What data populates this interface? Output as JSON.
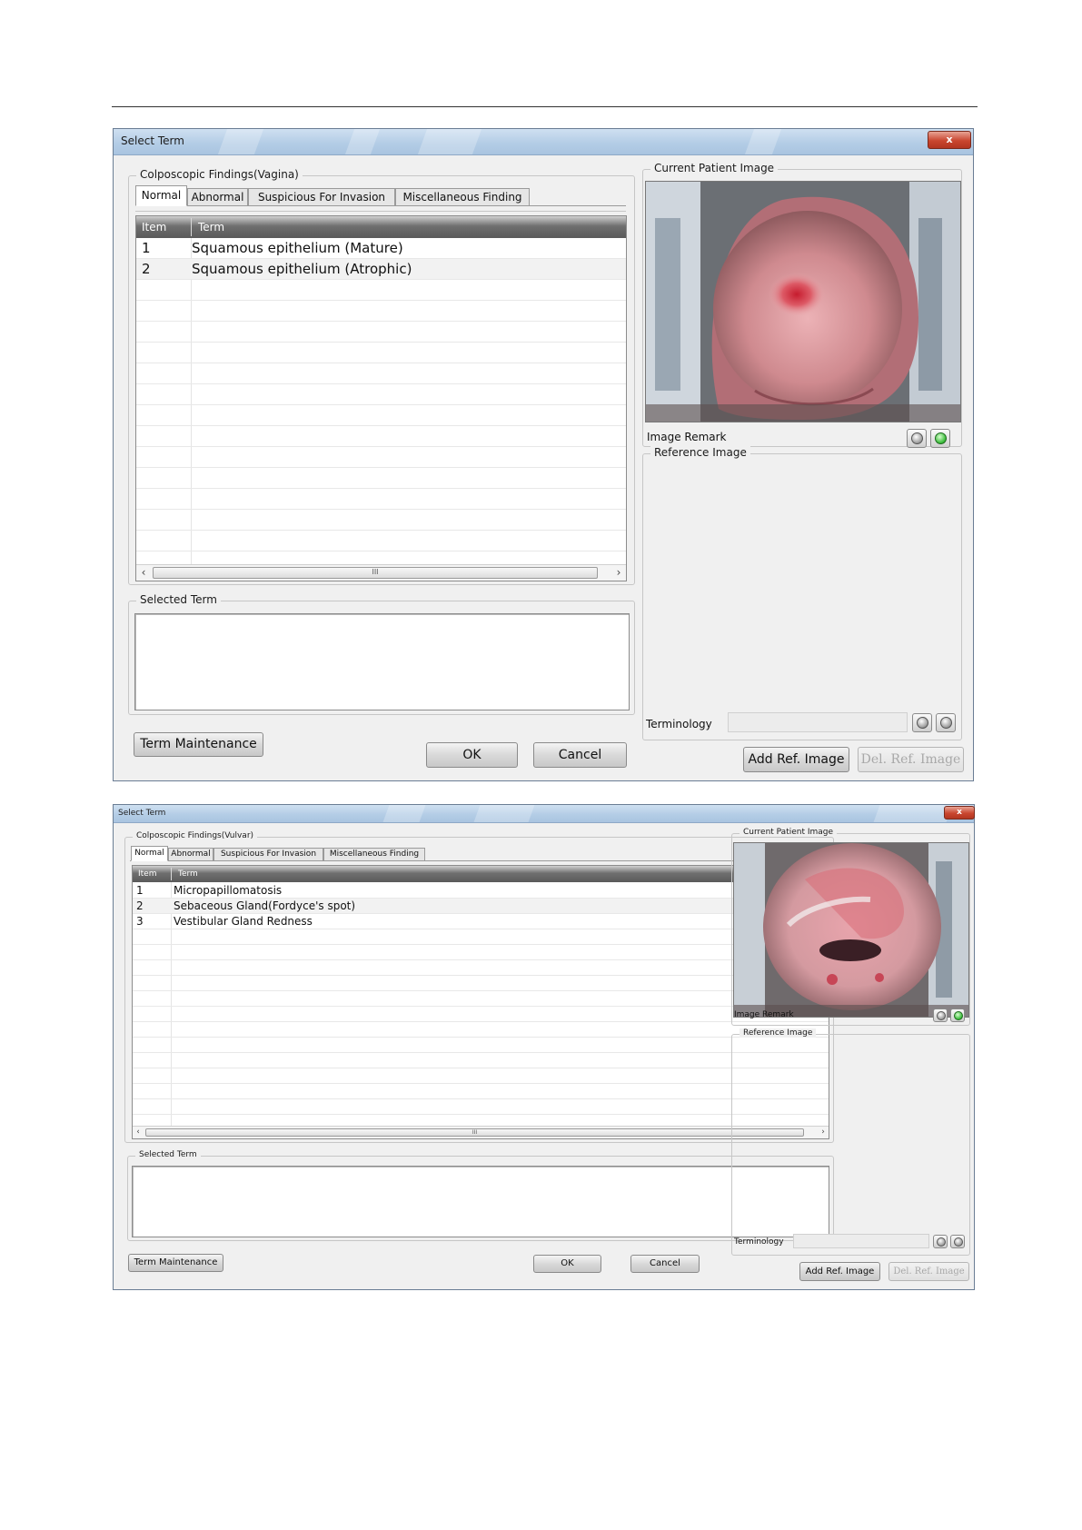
{
  "dialog1": {
    "title": "Select Term",
    "close_label": "x",
    "findings_group": "Colposcopic Findings(Vagina)",
    "tabs": [
      "Normal",
      "Abnormal",
      "Suspicious For Invasion",
      "Miscellaneous Finding"
    ],
    "active_tab": "Normal",
    "columns": [
      "Item",
      "Term"
    ],
    "rows": [
      {
        "item": "1",
        "term": "Squamous epithelium (Mature)"
      },
      {
        "item": "2",
        "term": "Squamous epithelium (Atrophic)"
      }
    ],
    "scroll_left": "‹",
    "scroll_right": "›",
    "scroll_thumb": "III",
    "selected_term_group": "Selected Term",
    "term_maintenance": "Term Maintenance",
    "ok": "OK",
    "cancel": "Cancel",
    "current_image_group": "Current Patient Image",
    "image_remark": "Image Remark",
    "reference_image_group": "Reference Image",
    "terminology": "Terminology",
    "add_ref": "Add Ref. Image",
    "del_ref": "Del. Ref. Image"
  },
  "dialog2": {
    "title": "Select Term",
    "close_label": "x",
    "findings_group": "Colposcopic Findings(Vulvar)",
    "tabs": [
      "Normal",
      "Abnormal",
      "Suspicious For Invasion",
      "Miscellaneous Finding"
    ],
    "active_tab": "Normal",
    "columns": [
      "Item",
      "Term"
    ],
    "rows": [
      {
        "item": "1",
        "term": "Micropapillomatosis"
      },
      {
        "item": "2",
        "term": "Sebaceous Gland(Fordyce's spot)"
      },
      {
        "item": "3",
        "term": "Vestibular Gland Redness"
      }
    ],
    "scroll_left": "‹",
    "scroll_right": "›",
    "scroll_thumb": "III",
    "selected_term_group": "Selected Term",
    "term_maintenance": "Term Maintenance",
    "ok": "OK",
    "cancel": "Cancel",
    "current_image_group": "Current Patient Image",
    "image_remark": "Image Remark",
    "reference_image_group": "Reference Image",
    "terminology": "Terminology",
    "add_ref": "Add Ref. Image",
    "del_ref": "Del. Ref. Image"
  },
  "colors": {
    "titlebar": "#b4cde6",
    "close_button": "#c9462f",
    "grid_header": "#5a5a5a",
    "dialog_bg": "#f0f0f0",
    "green_button": "#3fbf3f"
  },
  "icons": [
    "close-icon",
    "chevron-left-icon",
    "chevron-right-icon",
    "circle-grey-icon",
    "circle-green-icon"
  ]
}
